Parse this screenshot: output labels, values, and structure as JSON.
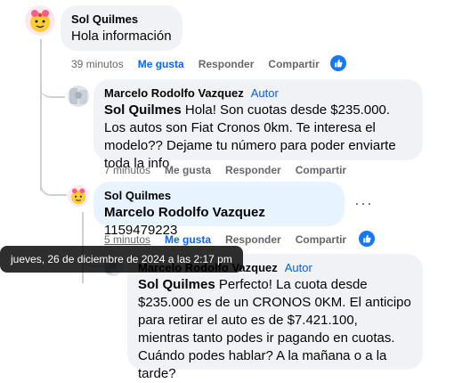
{
  "comments": [
    {
      "author": "Sol Quilmes",
      "text": "Hola información",
      "time": "39 minutos",
      "like_label": "Me gusta",
      "reply_label": "Responder",
      "share_label": "Compartir",
      "liked": true
    },
    {
      "author": "Marcelo Rodolfo Vazquez",
      "badge": "Autor",
      "mention": "Sol Quilmes",
      "text": " Hola! Son cuotas desde $235.000. Los autos son Fiat Cronos 0km. Te interesa el modelo?? Dejame tu número para poder enviarte toda la info",
      "time": "7 minutos",
      "like_label": "Me gusta",
      "reply_label": "Responder",
      "share_label": "Compartir"
    },
    {
      "author": "Sol Quilmes",
      "mention": "Marcelo Rodolfo Vazquez",
      "text": " 1159479223",
      "time": "5 minutos",
      "like_label": "Me gusta",
      "reply_label": "Responder",
      "share_label": "Compartir",
      "liked": true,
      "more_label": "···"
    },
    {
      "author": "Marcelo Rodolfo Vazquez",
      "badge": "Autor",
      "mention": "Sol Quilmes",
      "text": " Perfecto! La cuota desde $235.000 es de un CRONOS 0KM. El anticipo para retirar el auto es de $7.421.100, mientras tanto podes ir pagando en cuotas. Cuándo podes hablar? A la mañana o a la tarde?"
    }
  ],
  "tooltip": "jueves, 26 de diciembre de 2024 a las 2:17 pm",
  "colors": {
    "accent": "#0866ff",
    "like_badge": "#1877f2",
    "bubble": "#f0f2f5",
    "bubble_highlight": "#e7f3ff",
    "author_badge": "#0064d1",
    "meta": "#65676b"
  }
}
